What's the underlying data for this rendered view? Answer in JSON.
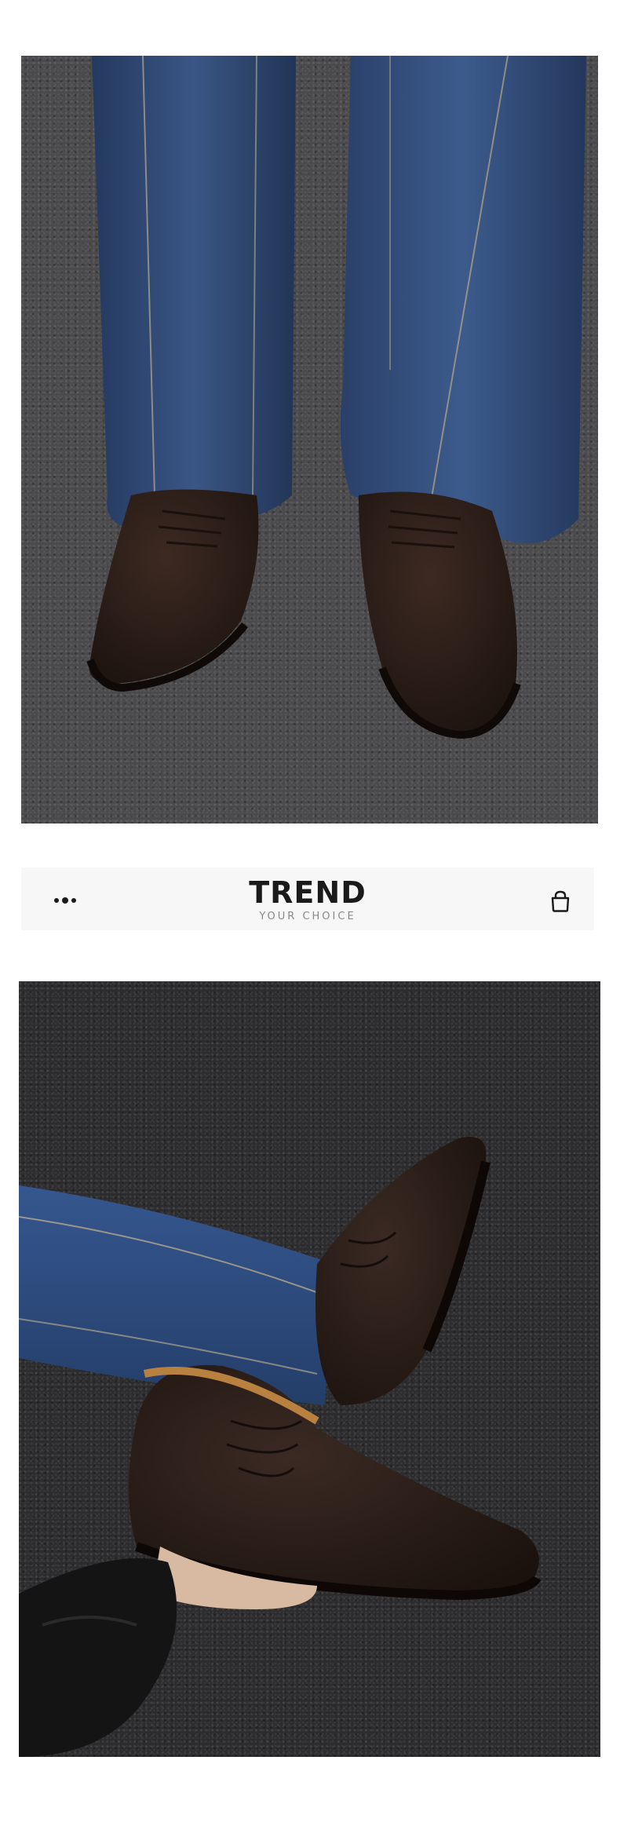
{
  "brand": {
    "title": "TREND",
    "tagline": "YOUR CHOICE"
  },
  "icons": {
    "menu": "more-dots-icon",
    "cart": "shopping-bag-icon"
  },
  "colors": {
    "background": "#ffffff",
    "bar_background": "#f7f7f7",
    "logo_text": "#1a1a1a",
    "tagline_text": "#8a8a8a",
    "boot_suede": "#2e1f1a",
    "denim": "#2f4a7a",
    "asphalt": "#4a4a4c"
  }
}
